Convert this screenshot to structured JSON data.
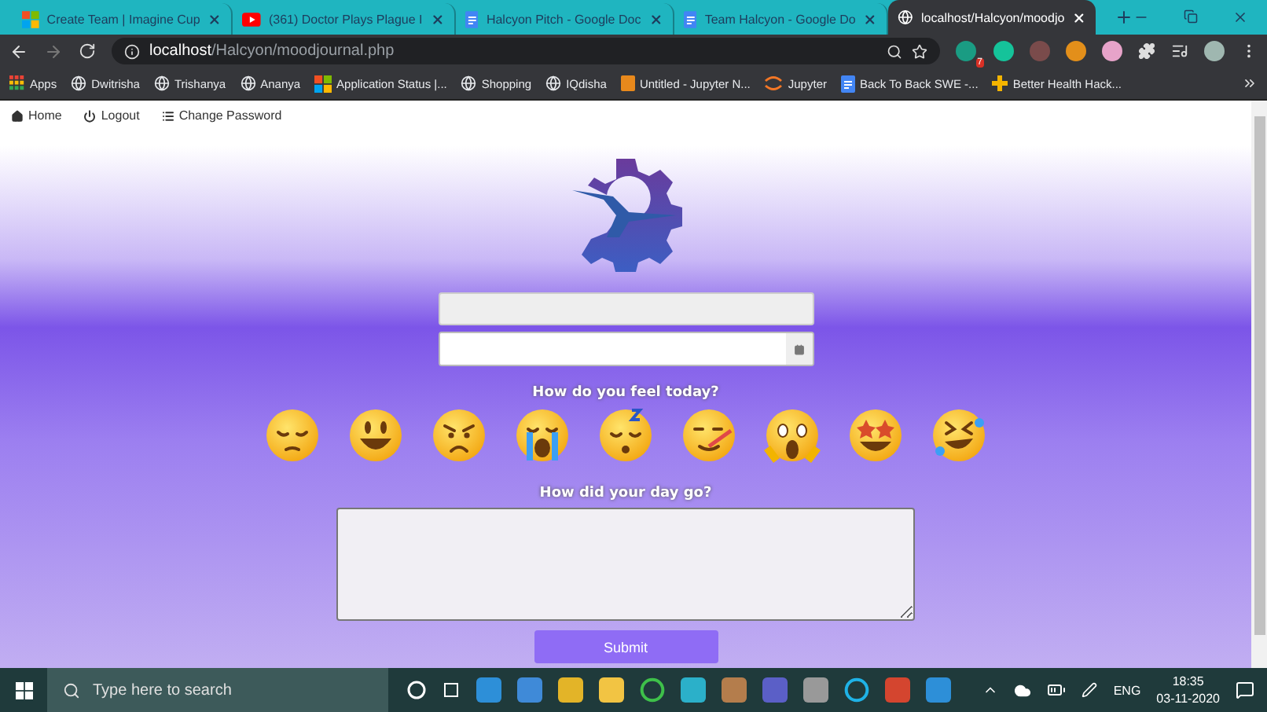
{
  "browser_tabs": [
    {
      "title": "Create Team | Imagine Cup",
      "selected": false
    },
    {
      "title": "(361) Doctor Plays Plague I",
      "selected": false
    },
    {
      "title": "Halcyon Pitch - Google Doc",
      "selected": false
    },
    {
      "title": "Team Halcyon - Google Do",
      "selected": false
    },
    {
      "title": "localhost/Halcyon/moodjo",
      "selected": true
    }
  ],
  "address_bar": {
    "host": "localhost",
    "path": "/Halcyon/moodjournal.php"
  },
  "extension_badge": "7",
  "bookmarks": [
    {
      "label": "Apps"
    },
    {
      "label": "Dwitrisha"
    },
    {
      "label": "Trishanya"
    },
    {
      "label": "Ananya"
    },
    {
      "label": "Application Status |..."
    },
    {
      "label": "Shopping"
    },
    {
      "label": "IQdisha"
    },
    {
      "label": "Untitled - Jupyter N..."
    },
    {
      "label": "Jupyter"
    },
    {
      "label": "Back To Back SWE -..."
    },
    {
      "label": "Better Health Hack..."
    }
  ],
  "nav_links": [
    {
      "label": "Home"
    },
    {
      "label": "Logout"
    },
    {
      "label": "Change Password"
    }
  ],
  "mood_question": "How do you feel today?",
  "day_question": "How did your day go?",
  "submit_label": "Submit",
  "taskbar": {
    "search_placeholder": "Type here to search",
    "language": "ENG",
    "time": "18:35",
    "date": "03-11-2020"
  }
}
